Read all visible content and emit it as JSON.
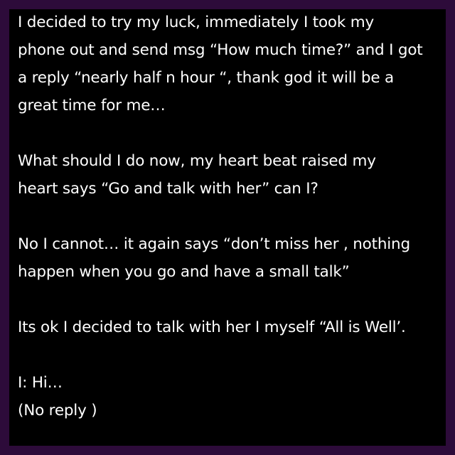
{
  "background_color": "#000000",
  "frame_color": "#2d0b3a",
  "text_color": "#ffffff",
  "paragraphs": [
    {
      "lines": [
        "I decided to try my luck, immediately I took my",
        "phone out and send msg “How much time?” and I got",
        "a reply “nearly half n hour “, thank god it will be a",
        "great time for me…"
      ]
    },
    {
      "lines": [
        "What should I do now, my heart beat raised my",
        "heart says “Go and talk with her” can I?"
      ]
    },
    {
      "lines": [
        "No I cannot… it again says “don’t miss her , nothing",
        "happen when you go and have a small talk”"
      ]
    },
    {
      "lines": [
        "Its ok I decided to talk with her I myself “All is Well’."
      ]
    },
    {
      "lines": [
        "I: Hi…",
        "(No reply )"
      ]
    }
  ]
}
